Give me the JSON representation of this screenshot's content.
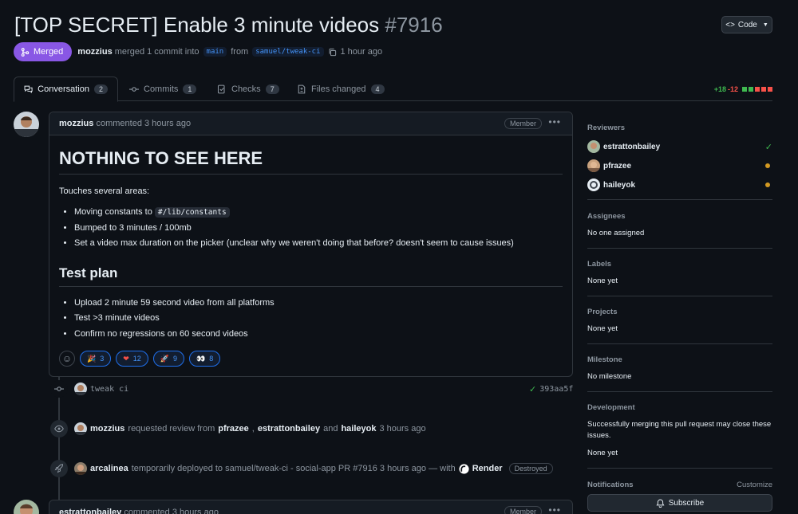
{
  "pr": {
    "title": "[TOP SECRET] Enable 3 minute videos",
    "number": "#7916",
    "code_button": "Code",
    "status": "Merged",
    "author": "mozzius",
    "merge_text": "merged 1 commit into",
    "base_branch": "main",
    "from_text": "from",
    "head_branch": "samuel/tweak-ci",
    "time": "1 hour ago"
  },
  "tabs": [
    {
      "label": "Conversation",
      "count": "2",
      "icon": "comment-discussion-icon"
    },
    {
      "label": "Commits",
      "count": "1",
      "icon": "git-commit-icon"
    },
    {
      "label": "Checks",
      "count": "7",
      "icon": "checklist-icon"
    },
    {
      "label": "Files changed",
      "count": "4",
      "icon": "file-diff-icon"
    }
  ],
  "diffstat": {
    "additions": "+18",
    "deletions": "-12",
    "add_color": "#3fb950",
    "del_color": "#f85149"
  },
  "comment": {
    "author": "mozzius",
    "action": "commented 3 hours ago",
    "role": "Member",
    "heading": "NOTHING TO SEE HERE",
    "intro": "Touches several areas:",
    "items": [
      {
        "pre": "Moving constants to ",
        "code": "#/lib/constants"
      },
      {
        "pre": "Bumped to 3 minutes / 100mb"
      },
      {
        "pre": "Set a video max duration on the picker (unclear why we weren't doing that before? doesn't seem to cause issues)"
      }
    ],
    "subheading": "Test plan",
    "plan": [
      "Upload 2 minute 59 second video from all platforms",
      "Test >3 minute videos",
      "Confirm no regressions on 60 second videos"
    ],
    "reactions": [
      {
        "emoji": "🎉",
        "count": "3"
      },
      {
        "emoji": "❤",
        "count": "12"
      },
      {
        "emoji": "🚀",
        "count": "9"
      },
      {
        "emoji": "👀",
        "count": "8"
      }
    ]
  },
  "timeline": {
    "commit": {
      "message": "tweak ci",
      "sha": "393aa5f"
    },
    "review": {
      "actor": "mozzius",
      "text": "requested review from",
      "r1": "pfrazee",
      "r2": "estrattonbailey",
      "and": "and",
      "r3": "haileyok",
      "time": "3 hours ago"
    },
    "deploy": {
      "actor": "arcalinea",
      "text": "temporarily deployed to samuel/tweak-ci - social-app PR #7916 3 hours ago — with",
      "service": "Render",
      "state": "Destroyed"
    }
  },
  "comment2": {
    "author": "estrattonbailey",
    "action": "commented 3 hours ago",
    "role": "Member"
  },
  "sidebar": {
    "reviewers_title": "Reviewers",
    "reviewers": [
      {
        "name": "estrattonbailey",
        "status": "approved"
      },
      {
        "name": "pfrazee",
        "status": "pending"
      },
      {
        "name": "haileyok",
        "status": "pending"
      }
    ],
    "assignees_title": "Assignees",
    "assignees_value": "No one assigned",
    "labels_title": "Labels",
    "labels_value": "None yet",
    "projects_title": "Projects",
    "projects_value": "None yet",
    "milestone_title": "Milestone",
    "milestone_value": "No milestone",
    "development_title": "Development",
    "development_text": "Successfully merging this pull request may close these issues.",
    "development_value": "None yet",
    "notifications_title": "Notifications",
    "customize": "Customize",
    "subscribe": "Subscribe"
  },
  "colors": {
    "merged": "#8957e5",
    "approved": "#3fb950",
    "pending": "#d29922",
    "link": "#4493f8"
  }
}
